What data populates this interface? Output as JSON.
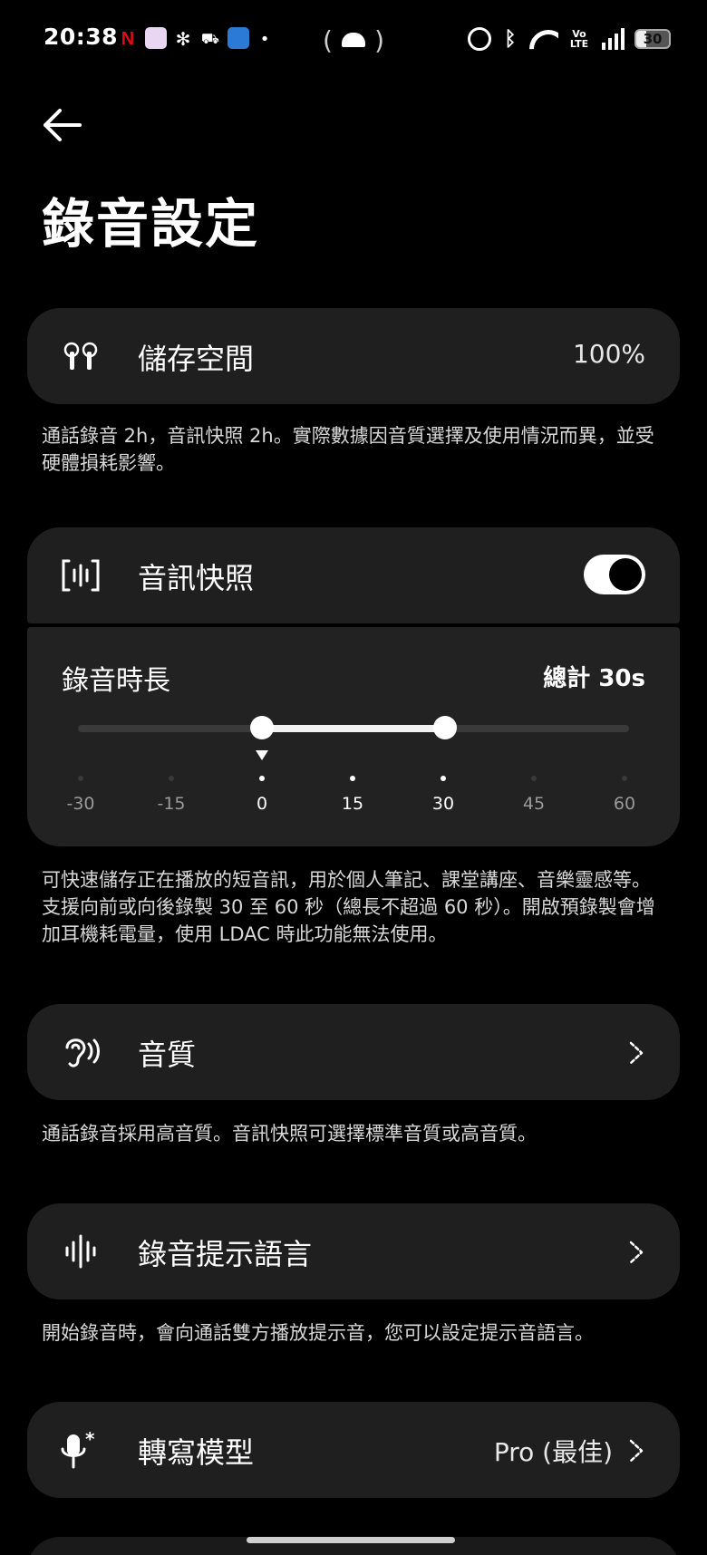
{
  "status_bar": {
    "time": "20:38",
    "netflix_icon": "N",
    "battery": "30",
    "volte": [
      "Vo",
      "LTE"
    ]
  },
  "header": {
    "title": "錄音設定"
  },
  "storage": {
    "label": "儲存空間",
    "value": "100%",
    "icon": "earbuds-icon",
    "note": "通話錄音 2h，音訊快照 2h。實際數據因音質選擇及使用情況而異，並受硬體損耗影響。"
  },
  "snapshot": {
    "label": "音訊快照",
    "icon": "audio-snapshot-icon",
    "enabled": true
  },
  "duration": {
    "label": "錄音時長",
    "total": "總計 30s",
    "min": -30,
    "max": 60,
    "range_start": 0,
    "range_end": 30,
    "marker": 0,
    "ticks": [
      "-30",
      "-15",
      "0",
      "15",
      "30",
      "45",
      "60"
    ]
  },
  "snapshot_note": "可快速儲存正在播放的短音訊，用於個人筆記、課堂講座、音樂靈感等。支援向前或向後錄製 30 至 60 秒（總長不超過 60 秒）。開啟預錄製會增加耳機耗電量，使用 LDAC 時此功能無法使用。",
  "quality": {
    "label": "音質",
    "icon": "ear-sound-icon",
    "note": "通話錄音採用高音質。音訊快照可選擇標準音質或高音質。"
  },
  "prompt_language": {
    "label": "錄音提示語言",
    "icon": "waveform-icon",
    "note": "開始錄音時，會向通話雙方播放提示音，您可以設定提示音語言。"
  },
  "transcription": {
    "label": "轉寫模型",
    "value": "Pro (最佳)",
    "icon": "mic-ai-icon"
  },
  "colors": {
    "background": "#000000",
    "card": "#1f1f1f",
    "accent": "#ffffff"
  }
}
